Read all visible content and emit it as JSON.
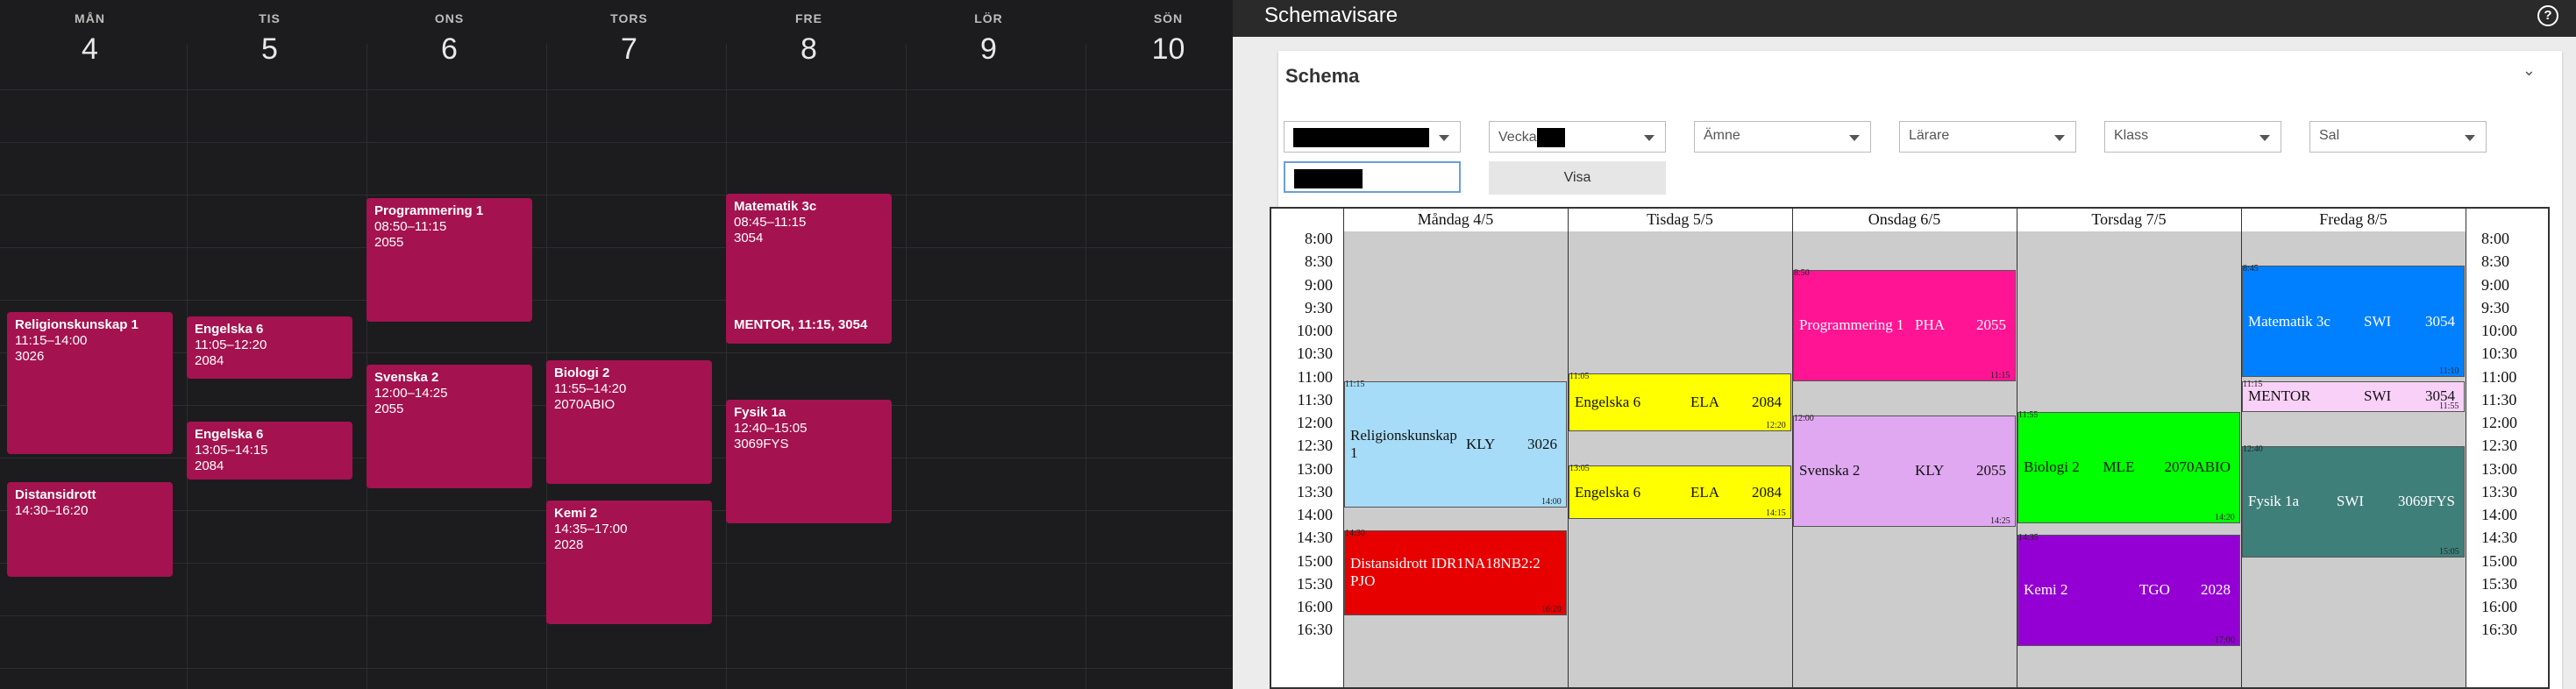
{
  "left": {
    "days": [
      {
        "wd": "MÅN",
        "dn": "4"
      },
      {
        "wd": "TIS",
        "dn": "5"
      },
      {
        "wd": "ONS",
        "dn": "6"
      },
      {
        "wd": "TORS",
        "dn": "7"
      },
      {
        "wd": "FRE",
        "dn": "8"
      },
      {
        "wd": "LÖR",
        "dn": "9"
      },
      {
        "wd": "SÖN",
        "dn": "10"
      }
    ],
    "events": [
      {
        "title": "Religionskunskap 1",
        "time": "11:15–14:00",
        "room": "3026"
      },
      {
        "title": "Distansidrott",
        "time": "14:30–16:20",
        "room": ""
      },
      {
        "title": "Engelska 6",
        "time": "11:05–12:20",
        "room": "2084"
      },
      {
        "title": "Engelska 6",
        "time": "13:05–14:15",
        "room": "2084"
      },
      {
        "title": "Programmering 1",
        "time": "08:50–11:15",
        "room": "2055"
      },
      {
        "title": "Svenska 2",
        "time": "12:00–14:25",
        "room": "2055"
      },
      {
        "title": "Biologi 2",
        "time": "11:55–14:20",
        "room": "2070ABIO"
      },
      {
        "title": "Kemi 2",
        "time": "14:35–17:00",
        "room": "2028"
      },
      {
        "title": "Matematik 3c",
        "time": "08:45–11:15",
        "room": "3054"
      },
      {
        "title": "MENTOR, 11:15, 3054",
        "time": "",
        "room": ""
      },
      {
        "title": "Fysik 1a",
        "time": "12:40–15:05",
        "room": "3069FYS"
      }
    ]
  },
  "right": {
    "app_title": "Schemavisare",
    "help_icon": "?",
    "panel_title": "Schema",
    "collapse_icon": "⌄",
    "filters": {
      "vecka_label": "Vecka",
      "amne": "Ämne",
      "larare": "Lärare",
      "klass": "Klass",
      "sal": "Sal",
      "visa": "Visa"
    },
    "columns": [
      "Måndag 4/5",
      "Tisdag 5/5",
      "Onsdag 6/5",
      "Torsdag 7/5",
      "Fredag 8/5"
    ],
    "times": [
      "8:00",
      "8:30",
      "9:00",
      "9:30",
      "10:00",
      "10:30",
      "11:00",
      "11:30",
      "12:00",
      "12:30",
      "13:00",
      "13:30",
      "14:00",
      "14:30",
      "15:00",
      "15:30",
      "16:00",
      "16:30"
    ],
    "lessons": [
      {
        "subject": "Religionskunskap 1",
        "teacher": "KLY",
        "room": "3026",
        "start": "11:15",
        "end": "14:00",
        "color": "#a6dcf7"
      },
      {
        "subject": "Distansidrott IDR1NA18NB2:2 PJO",
        "teacher": "",
        "room": "",
        "start": "14:30",
        "end": "16:20",
        "color": "#e60000"
      },
      {
        "subject": "Engelska 6",
        "teacher": "ELA",
        "room": "2084",
        "start": "11:05",
        "end": "12:20",
        "color": "#ffff00"
      },
      {
        "subject": "Engelska 6",
        "teacher": "ELA",
        "room": "2084",
        "start": "13:05",
        "end": "14:15",
        "color": "#ffff00"
      },
      {
        "subject": "Programmering 1",
        "teacher": "PHA",
        "room": "2055",
        "start": "8:50",
        "end": "11:15",
        "color": "#ff1493"
      },
      {
        "subject": "Svenska 2",
        "teacher": "KLY",
        "room": "2055",
        "start": "12:00",
        "end": "14:25",
        "color": "#e0a8f0"
      },
      {
        "subject": "Biologi 2",
        "teacher": "MLE",
        "room": "2070ABIO",
        "start": "11:55",
        "end": "14:20",
        "color": "#00ff00"
      },
      {
        "subject": "Kemi 2",
        "teacher": "TGO",
        "room": "2028",
        "start": "14:35",
        "end": "17:00",
        "color": "#9400d3"
      },
      {
        "subject": "Matematik 3c",
        "teacher": "SWI",
        "room": "3054",
        "start": "8:45",
        "end": "11:10",
        "color": "#0080ff"
      },
      {
        "subject": "MENTOR",
        "teacher": "SWI",
        "room": "3054",
        "start": "11:15",
        "end": "11:55",
        "color": "#f8d0f8"
      },
      {
        "subject": "Fysik 1a",
        "teacher": "SWI",
        "room": "3069FYS",
        "start": "12:40",
        "end": "15:05",
        "color": "#3f7f7a"
      }
    ]
  }
}
